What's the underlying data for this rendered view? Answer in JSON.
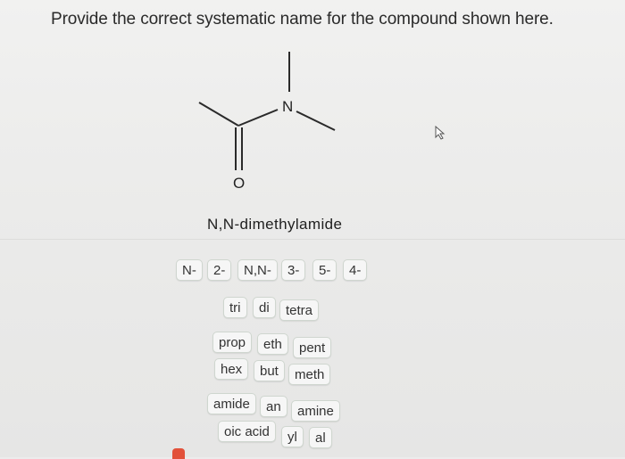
{
  "question": {
    "text": "Provide the correct systematic name for the compound shown here."
  },
  "structure": {
    "nitrogen_label": "N",
    "oxygen_label": "O"
  },
  "answer": {
    "text": "N,N-dimethylamide"
  },
  "chips": {
    "locants": [
      "N-",
      "2-",
      "N,N-",
      "3-",
      "5-",
      "4-"
    ],
    "multipliers": [
      "tri",
      "di",
      "tetra"
    ],
    "stems_row1": [
      "prop",
      "eth",
      "pent"
    ],
    "stems_row2": [
      "hex",
      "but",
      "meth"
    ],
    "suffixes_row1": [
      "amide",
      "an",
      "amine"
    ],
    "suffixes_row2": [
      "oic acid",
      "yl",
      "al"
    ]
  },
  "colors": {
    "background": "#ececec",
    "chip_border": "#cfd6cf",
    "bottom_tab": "#e2513a"
  }
}
